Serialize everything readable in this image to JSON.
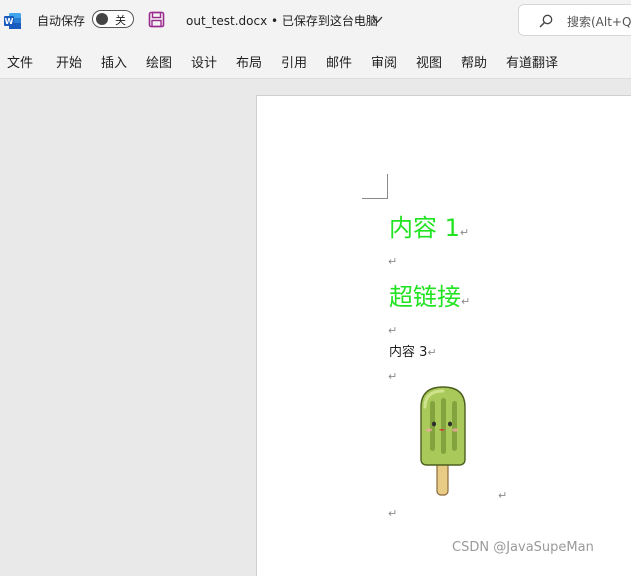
{
  "titlebar": {
    "app_icon": "word-icon",
    "app_letter": "W",
    "autosave_label": "自动保存",
    "autosave_toggle": "关",
    "save_icon": "save-icon",
    "document_title": "out_test.docx • 已保存到这台电脑",
    "search_placeholder": "搜索(Alt+Q)",
    "search_icon": "search-icon"
  },
  "menubar": {
    "tabs": [
      "文件",
      "开始",
      "插入",
      "绘图",
      "设计",
      "布局",
      "引用",
      "邮件",
      "审阅",
      "视图",
      "帮助",
      "有道翻译"
    ]
  },
  "document": {
    "paragraph_mark": "↵",
    "paragraphs": [
      {
        "text": "内容 1",
        "style": "heading",
        "color": "#22e322"
      },
      {
        "text": "",
        "style": "empty"
      },
      {
        "text": "超链接",
        "style": "heading",
        "color": "#22e322"
      },
      {
        "text": "",
        "style": "empty"
      },
      {
        "text": "内容 3",
        "style": "normal"
      },
      {
        "text": "",
        "style": "empty"
      },
      {
        "image": "popsicle-image"
      },
      {
        "text": "",
        "style": "empty"
      }
    ]
  },
  "watermark": "CSDN @JavaSupeMan",
  "colors": {
    "word_blue": "#185abd",
    "heading_green": "#22e322",
    "save_purple": "#9b2a8f"
  }
}
